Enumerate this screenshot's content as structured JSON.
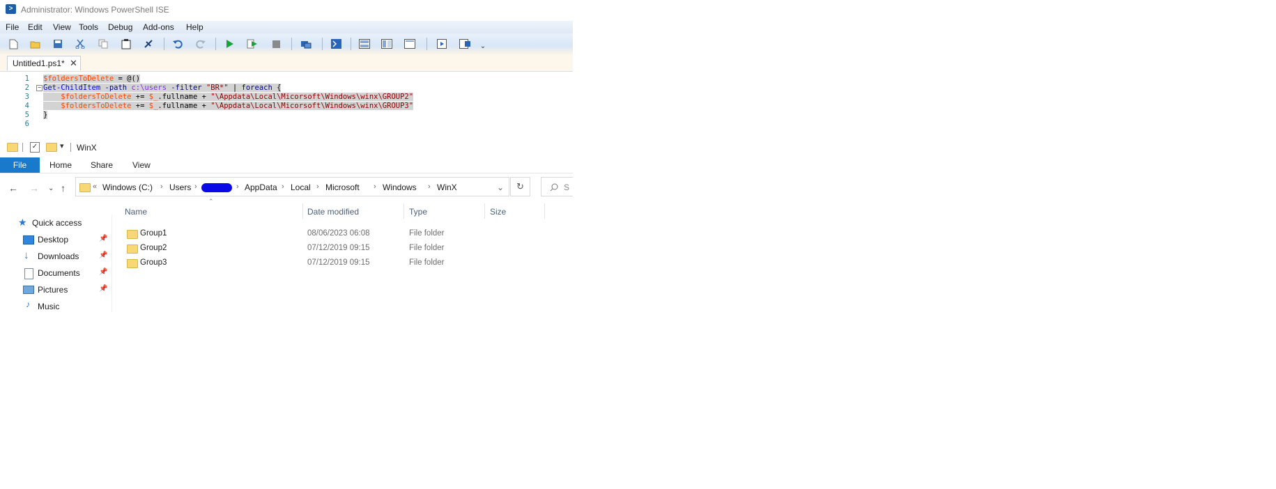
{
  "ise": {
    "title": "Administrator: Windows PowerShell ISE",
    "menu": [
      "File",
      "Edit",
      "View",
      "Tools",
      "Debug",
      "Add-ons",
      "Help"
    ],
    "tab": {
      "label": "Untitled1.ps1*",
      "close": "✕"
    },
    "code_lines": [
      {
        "num": "1",
        "tokens": [
          [
            "var",
            "$foldersToDelete"
          ],
          [
            "plain",
            " = "
          ],
          [
            "plain",
            "@()"
          ]
        ]
      },
      {
        "num": "2",
        "fold": "−",
        "tokens": [
          [
            "cmd",
            "Get-ChildItem"
          ],
          [
            "plain",
            " "
          ],
          [
            "param",
            "-path"
          ],
          [
            "plain",
            " "
          ],
          [
            "path",
            "c:\\users"
          ],
          [
            "plain",
            " "
          ],
          [
            "param",
            "-filter"
          ],
          [
            "plain",
            " "
          ],
          [
            "str",
            "\"BR*\""
          ],
          [
            "plain",
            " | "
          ],
          [
            "kw",
            "foreach"
          ],
          [
            "plain",
            " {"
          ]
        ]
      },
      {
        "num": "3",
        "tokens": [
          [
            "plain",
            "    "
          ],
          [
            "var",
            "$foldersToDelete"
          ],
          [
            "plain",
            " += "
          ],
          [
            "var",
            "$_"
          ],
          [
            "plain",
            ".fullname + "
          ],
          [
            "str",
            "\"\\Appdata\\Local\\Micorsoft\\Windows\\winx\\GROUP2\""
          ]
        ]
      },
      {
        "num": "4",
        "tokens": [
          [
            "plain",
            "    "
          ],
          [
            "var",
            "$foldersToDelete"
          ],
          [
            "plain",
            " += "
          ],
          [
            "var",
            "$_"
          ],
          [
            "plain",
            ".fullname + "
          ],
          [
            "str",
            "\"\\Appdata\\Local\\Micorsoft\\Windows\\winx\\GROUP3\""
          ]
        ]
      },
      {
        "num": "5",
        "tokens": [
          [
            "plain",
            "}"
          ]
        ]
      },
      {
        "num": "6",
        "tokens": []
      }
    ]
  },
  "explorer": {
    "window_title": "WinX",
    "ribbon": {
      "file": "File",
      "tabs": [
        "Home",
        "Share",
        "View"
      ]
    },
    "breadcrumb": [
      "Windows (C:)",
      "Users",
      "AppData",
      "Local",
      "Microsoft",
      "Windows",
      "WinX"
    ],
    "breadcrumb_overflow": "«",
    "search_placeholder": "S",
    "nav": [
      {
        "label": "Quick access",
        "icon": "star-icon"
      },
      {
        "label": "Desktop",
        "icon": "desktop-icon",
        "pinned": true
      },
      {
        "label": "Downloads",
        "icon": "download-icon",
        "pinned": true
      },
      {
        "label": "Documents",
        "icon": "documents-icon",
        "pinned": true
      },
      {
        "label": "Pictures",
        "icon": "pictures-icon",
        "pinned": true
      },
      {
        "label": "Music",
        "icon": "music-icon"
      }
    ],
    "columns": [
      "Name",
      "Date modified",
      "Type",
      "Size"
    ],
    "rows": [
      {
        "name": "Group1",
        "date": "08/06/2023 06:08",
        "type": "File folder",
        "size": ""
      },
      {
        "name": "Group2",
        "date": "07/12/2019 09:15",
        "type": "File folder",
        "size": ""
      },
      {
        "name": "Group3",
        "date": "07/12/2019 09:15",
        "type": "File folder",
        "size": ""
      }
    ]
  },
  "colors": {
    "file_tab": "#1979ca",
    "folder": "#f8d775",
    "redaction": "#0a0ae6"
  }
}
